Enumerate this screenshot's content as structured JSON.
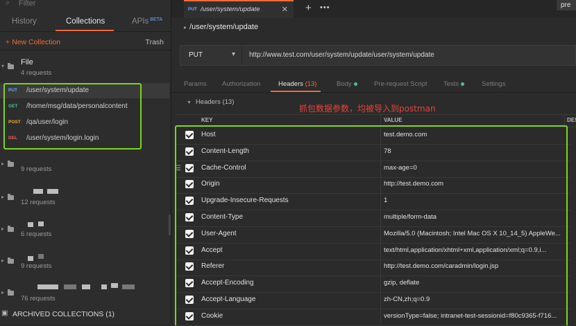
{
  "sidebar": {
    "filter_placeholder": "Filter",
    "tabs": [
      {
        "label": "History"
      },
      {
        "label": "Collections"
      },
      {
        "label": "APIs",
        "badge": "BETA"
      }
    ],
    "new_collection": "New Collection",
    "trash": "Trash",
    "collections": [
      {
        "name": "File",
        "requests": "4 requests"
      },
      {
        "name": "",
        "requests": "9 requests"
      },
      {
        "name": "",
        "requests": "12 requests"
      },
      {
        "name": "",
        "requests": "6 requests"
      },
      {
        "name": "",
        "requests": "9 requests"
      },
      {
        "name": "",
        "requests": "76 requests"
      }
    ],
    "requests": [
      {
        "method": "PUT",
        "path": "/user/system/update"
      },
      {
        "method": "GET",
        "path": "/home/msg/data/personalcontent"
      },
      {
        "method": "POST",
        "path": "/qa/user/login"
      },
      {
        "method": "DEL",
        "path": "/user/system/login.login"
      }
    ],
    "archived": "ARCHIVED COLLECTIONS (1)"
  },
  "tabbar": {
    "tab": {
      "method": "PUT",
      "title": "/user/system/update"
    },
    "plus": "+",
    "more": "•••",
    "preview": "pre"
  },
  "request": {
    "title": "/user/system/update",
    "method": "PUT",
    "url": "http://www.test.com/user/system/update/user/system/update"
  },
  "subtabs": {
    "params": "Params",
    "authorization": "Authorization",
    "headers": "Headers",
    "headers_count": "(13)",
    "body": "Body",
    "prerequest": "Pre-request Script",
    "tests": "Tests",
    "settings": "Settings"
  },
  "headers_section": "Headers (13)",
  "note": "抓包数据参数，均被导入到postman",
  "table": {
    "key_header": "KEY",
    "value_header": "VALUE",
    "desc_header": "DES",
    "rows": [
      {
        "key": "Host",
        "value": "test.demo.com"
      },
      {
        "key": "Content-Length",
        "value": "78"
      },
      {
        "key": "Cache-Control",
        "value": "max-age=0"
      },
      {
        "key": "Origin",
        "value": "http://test.demo.com"
      },
      {
        "key": "Upgrade-Insecure-Requests",
        "value": "1"
      },
      {
        "key": "Content-Type",
        "value": "multiple/form-data"
      },
      {
        "key": "User-Agent",
        "value": "Mozilla/5.0 (Macintosh; Intel Mac OS X 10_14_5) AppleWe..."
      },
      {
        "key": "Accept",
        "value": "text/html,application/xhtml+xml,application/xml;q=0.9,i..."
      },
      {
        "key": "Referer",
        "value": "http://test.demo.com/caradmin/login.jsp"
      },
      {
        "key": "Accept-Encoding",
        "value": "gzip, deflate"
      },
      {
        "key": "Accept-Language",
        "value": "zh-CN,zh;q=0.9"
      },
      {
        "key": "Cookie",
        "value": "versionType=false; intranet-test-sessionid=f80c9365-f716..."
      }
    ]
  },
  "colors": {
    "accent": "#f26b3a",
    "highlight": "#7ed321",
    "note": "#e8433a"
  }
}
